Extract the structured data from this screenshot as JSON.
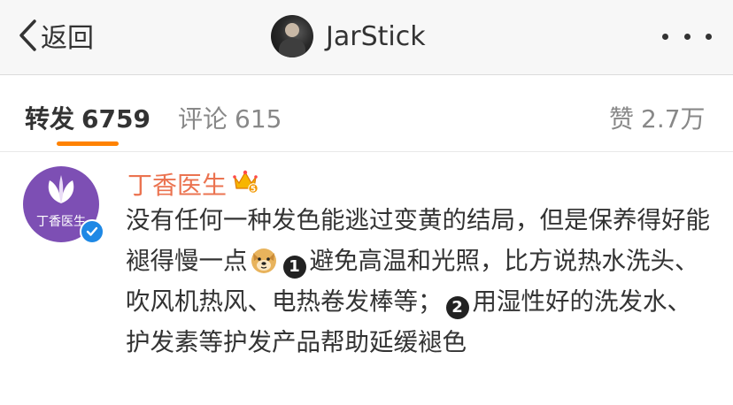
{
  "navbar": {
    "back_label": "返回",
    "username": "JarStick",
    "icons": {
      "back": "chevron-left-icon",
      "more": "more-dots-icon"
    }
  },
  "tabs": [
    {
      "label": "转发",
      "count": "6759",
      "active": true
    },
    {
      "label": "评论",
      "count": "615",
      "active": false
    },
    {
      "label": "赞",
      "count": "2.7万",
      "active": false
    }
  ],
  "post": {
    "author": "丁香医生",
    "avatar_text": "丁香医生",
    "member_badge_level": "5",
    "content": {
      "part1": "没有任何一种发色能逃过变黄的结局，但是保养得好能褪得慢一点",
      "num1": "1",
      "part2": "避免高温和光照，比方说热水洗头、吹风机热风、电热卷发棒等；",
      "num2": "2",
      "part3": "用湿性好的洗发水、护发素等护发产品帮助延缓褪色"
    }
  },
  "colors": {
    "accent": "#ff8200",
    "author_name": "#eb7350",
    "avatar_bg": "#7d4fb4",
    "verified": "#1e88e5"
  }
}
